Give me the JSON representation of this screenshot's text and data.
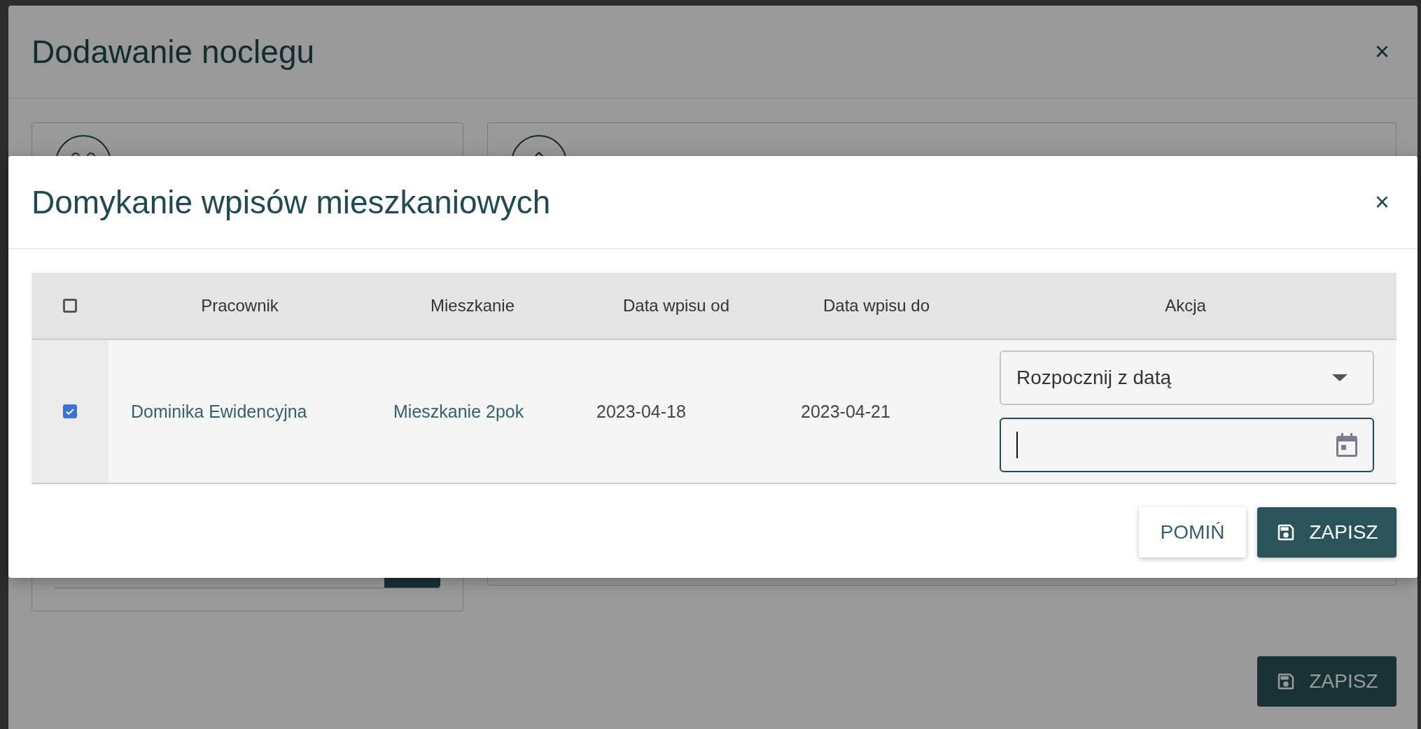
{
  "background_dialog": {
    "title": "Dodawanie noclegu",
    "close": "×",
    "save_button": "ZAPISZ"
  },
  "dialog": {
    "title": "Domykanie wpisów mieszkaniowych",
    "close": "×",
    "table": {
      "select_all": {
        "checked": false
      },
      "columns": [
        "Pracownik",
        "Mieszkanie",
        "Data wpisu od",
        "Data wpisu do",
        "Akcja"
      ],
      "rows": [
        {
          "checked": true,
          "employee": "Dominika Ewidencyjna",
          "apartment": "Mieszkanie 2pok",
          "date_from": "2023-04-18",
          "date_to": "2023-04-21",
          "action": "Rozpocznij z datą"
        }
      ]
    },
    "buttons": [
      {
        "kind": "secondary",
        "label": "POMIŃ"
      },
      {
        "kind": "primary",
        "label": "ZAPISZ"
      }
    ]
  }
}
